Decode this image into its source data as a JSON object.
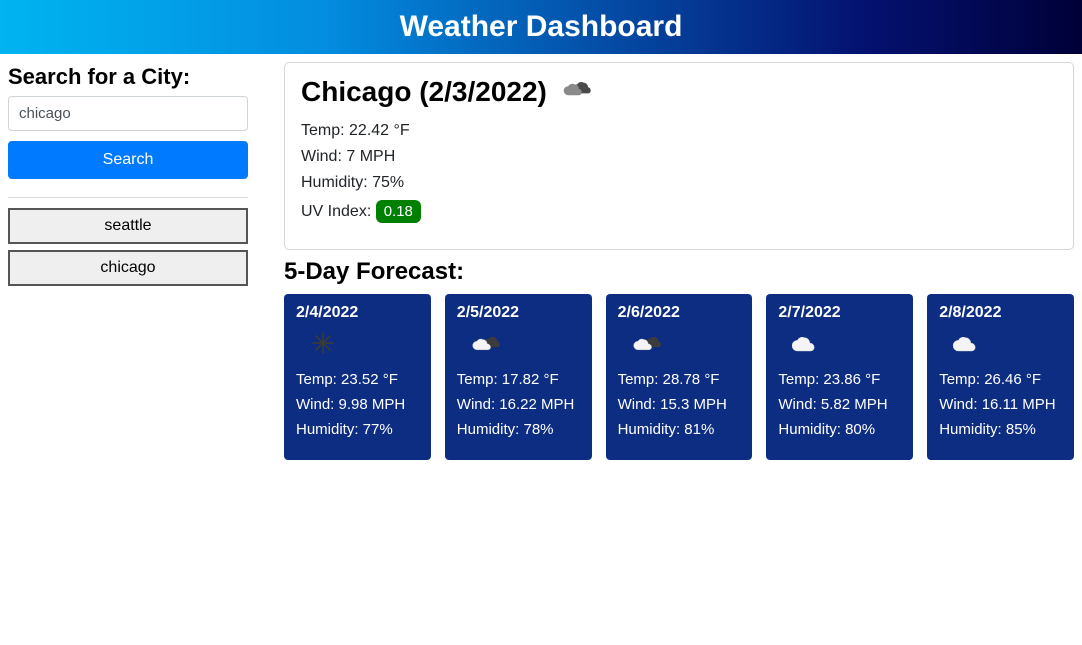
{
  "header": {
    "title": "Weather Dashboard"
  },
  "search": {
    "label": "Search for a City:",
    "input_value": "chicago",
    "button_label": "Search"
  },
  "history": [
    {
      "label": "seattle"
    },
    {
      "label": "chicago"
    }
  ],
  "current": {
    "title": "Chicago (2/3/2022)",
    "icon": "cloud-dark",
    "temp_label": "Temp: 22.42 °F",
    "wind_label": "Wind: 7 MPH",
    "humidity_label": "Humidity: 75%",
    "uv_prefix": "UV Index: ",
    "uv_value": "0.18",
    "uv_color": "#008000"
  },
  "forecast": {
    "title": "5-Day Forecast:",
    "days": [
      {
        "date": "2/4/2022",
        "icon": "snow",
        "temp": "Temp: 23.52 °F",
        "wind": "Wind: 9.98 MPH",
        "humidity": "Humidity: 77%"
      },
      {
        "date": "2/5/2022",
        "icon": "cloud-mix",
        "temp": "Temp: 17.82 °F",
        "wind": "Wind: 16.22 MPH",
        "humidity": "Humidity: 78%"
      },
      {
        "date": "2/6/2022",
        "icon": "cloud-mix",
        "temp": "Temp: 28.78 °F",
        "wind": "Wind: 15.3 MPH",
        "humidity": "Humidity: 81%"
      },
      {
        "date": "2/7/2022",
        "icon": "cloud-white",
        "temp": "Temp: 23.86 °F",
        "wind": "Wind: 5.82 MPH",
        "humidity": "Humidity: 80%"
      },
      {
        "date": "2/8/2022",
        "icon": "cloud-white",
        "temp": "Temp: 26.46 °F",
        "wind": "Wind: 16.11 MPH",
        "humidity": "Humidity: 85%"
      }
    ]
  }
}
